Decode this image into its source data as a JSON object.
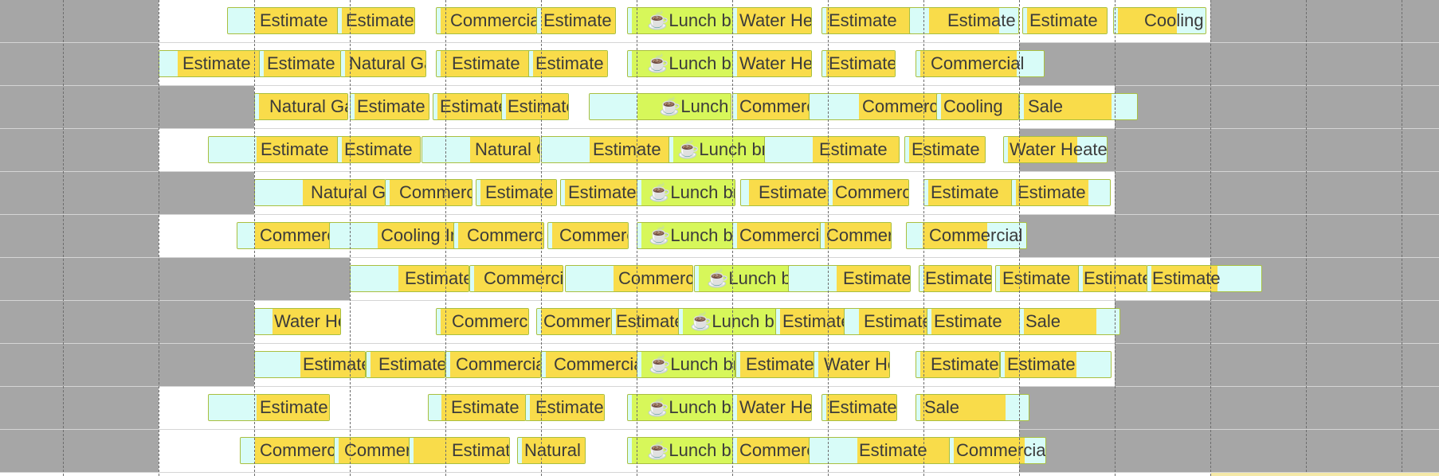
{
  "colors": {
    "event_fill": "#f9dc4a",
    "lunch_fill": "#d7f75a",
    "padding_fill": "#d8fcf8",
    "event_border": "#a9bf40",
    "non_working_fill": "#a6a6a6",
    "working_fill": "#ffffff",
    "grid_line": "#6e6e6e"
  },
  "icons": {
    "lunch": "coffee-cup-icon"
  },
  "rows": [
    {
      "events": [
        {
          "label": "Estimate"
        },
        {
          "label": "Estimate"
        },
        {
          "label": "Commercial"
        },
        {
          "label": "Estimate"
        },
        {
          "label": "☕Lunch break",
          "lunch": true
        },
        {
          "label": "Water Heater"
        },
        {
          "label": "Estimate"
        },
        {
          "label": "Estimate"
        },
        {
          "label": "Estimate"
        },
        {
          "label": "Cooling"
        }
      ]
    },
    {
      "events": [
        {
          "label": "Estimate"
        },
        {
          "label": "Estimate"
        },
        {
          "label": "Natural Gas"
        },
        {
          "label": "Estimate"
        },
        {
          "label": "Estimate"
        },
        {
          "label": "☕Lunch break",
          "lunch": true
        },
        {
          "label": "Water Heater"
        },
        {
          "label": "Estimate"
        },
        {
          "label": "Commercial"
        }
      ]
    },
    {
      "events": [
        {
          "label": "Natural Gas"
        },
        {
          "label": "Estimate"
        },
        {
          "label": "Estimate"
        },
        {
          "label": "Estimate"
        },
        {
          "label": "☕Lunch break",
          "lunch": true
        },
        {
          "label": "Commercial"
        },
        {
          "label": "Commercial"
        },
        {
          "label": "Cooling"
        },
        {
          "label": "Sale"
        }
      ]
    },
    {
      "events": [
        {
          "label": "Estimate"
        },
        {
          "label": "Estimate"
        },
        {
          "label": "Natural Gas"
        },
        {
          "label": "Estimate"
        },
        {
          "label": "☕Lunch break",
          "lunch": true
        },
        {
          "label": "Estimate"
        },
        {
          "label": "Estimate"
        },
        {
          "label": "Water Heater"
        }
      ]
    },
    {
      "events": [
        {
          "label": "Natural Gas"
        },
        {
          "label": "Commercial"
        },
        {
          "label": "Estimate"
        },
        {
          "label": "Estimate"
        },
        {
          "label": "☕Lunch break",
          "lunch": true
        },
        {
          "label": "Estimate"
        },
        {
          "label": "Commercial"
        },
        {
          "label": "Estimate"
        },
        {
          "label": "Estimate"
        }
      ]
    },
    {
      "events": [
        {
          "label": "Commercial"
        },
        {
          "label": "Cooling Install"
        },
        {
          "label": "Commercial"
        },
        {
          "label": "Commercial"
        },
        {
          "label": "☕Lunch break",
          "lunch": true
        },
        {
          "label": "Commercial"
        },
        {
          "label": "Commercial"
        },
        {
          "label": "Commercial"
        }
      ]
    },
    {
      "events": [
        {
          "label": "Estimate"
        },
        {
          "label": "Commercial"
        },
        {
          "label": "Commercial"
        },
        {
          "label": "☕Lunch break",
          "lunch": true
        },
        {
          "label": "Estimate"
        },
        {
          "label": "Estimate"
        },
        {
          "label": "Estimate"
        },
        {
          "label": "Estimate"
        },
        {
          "label": "Estimate"
        }
      ]
    },
    {
      "events": [
        {
          "label": "Water Heater"
        },
        {
          "label": "Commercial"
        },
        {
          "label": "Commercial"
        },
        {
          "label": "Estimate"
        },
        {
          "label": "☕Lunch break",
          "lunch": true
        },
        {
          "label": "Estimate"
        },
        {
          "label": "Estimate"
        },
        {
          "label": "Estimate"
        },
        {
          "label": "Sale"
        }
      ]
    },
    {
      "events": [
        {
          "label": "Estimate"
        },
        {
          "label": "Estimate"
        },
        {
          "label": "Commercial"
        },
        {
          "label": "Commercial"
        },
        {
          "label": "☕Lunch break",
          "lunch": true
        },
        {
          "label": "Estimate"
        },
        {
          "label": "Water Heater"
        },
        {
          "label": "Estimate"
        },
        {
          "label": "Estimate"
        }
      ]
    },
    {
      "events": [
        {
          "label": "Estimate"
        },
        {
          "label": "Estimate"
        },
        {
          "label": "Estimate"
        },
        {
          "label": "☕Lunch break",
          "lunch": true
        },
        {
          "label": "Water Heater"
        },
        {
          "label": "Estimate"
        },
        {
          "label": "Sale"
        }
      ]
    },
    {
      "events": [
        {
          "label": "Commercial"
        },
        {
          "label": "Commercial"
        },
        {
          "label": "Estimate"
        },
        {
          "label": "Natural Gas"
        },
        {
          "label": "☕Lunch break",
          "lunch": true
        },
        {
          "label": "Commercial"
        },
        {
          "label": "Estimate"
        },
        {
          "label": "Commercial"
        }
      ]
    }
  ]
}
